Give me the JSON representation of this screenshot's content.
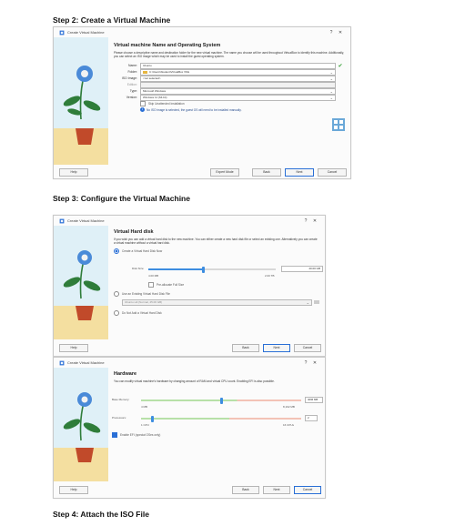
{
  "steps": {
    "step2": "Step 2: Create a Virtual Machine",
    "step3": "Step 3: Configure the Virtual Machine",
    "step4": "Step 4: Attach the ISO File"
  },
  "dialog1": {
    "window_title": "Create Virtual Machine",
    "heading": "Virtual machine Name and Operating System",
    "description": "Please choose a descriptive name and destination folder for the new virtual machine. The name you choose will be used throughout VirtualBox to identify this machine. Additionally, you can select an ISO image which may be used to install the guest operating system.",
    "fields": [
      {
        "label": "Name:",
        "value": "Ubuntu",
        "disabled": false
      },
      {
        "label": "Folder:",
        "value": "C:\\Users\\Student\\VirtualBox VMs",
        "disabled": false
      },
      {
        "label": "ISO Image:",
        "value": "<not selected>",
        "disabled": false
      },
      {
        "label": "Edition:",
        "value": "",
        "disabled": true
      },
      {
        "label": "Type:",
        "value": "Microsoft Windows",
        "disabled": false
      },
      {
        "label": "Version:",
        "value": "Windows 11 (64-bit)",
        "disabled": false
      }
    ],
    "skip_unattended": "Skip Unattended Installation",
    "info": "No ISO image is selected, the guest OS will need to be installed manually.",
    "buttons": {
      "help": "Help",
      "expert": "Expert Mode",
      "back": "Back",
      "next": "Next",
      "cancel": "Cancel"
    }
  },
  "dialog2": {
    "window_title": "Create Virtual Machine",
    "heading": "Virtual Hard disk",
    "description": "If you wish you can add a virtual hard disk to the new machine. You can either create a new hard disk file or select an existing one. Alternatively you can create a virtual machine without a virtual hard disk.",
    "option_create": "Create a Virtual Hard Disk Now",
    "disk_size_label": "Disk Size:",
    "disk_size_value": "40.00 GB",
    "disk_min": "4.00 MB",
    "disk_max": "2.00 TB",
    "disk_fraction": 0.43,
    "prealloc": "Pre-allocate Full Size",
    "option_existing": "Use an Existing Virtual Hard Disk File",
    "existing_value": "Ubuntu.vdi (Normal, 25.00 GB)",
    "option_none": "Do Not Add a Virtual Hard Disk",
    "buttons": {
      "help": "Help",
      "back": "Back",
      "next": "Next",
      "cancel": "Cancel"
    }
  },
  "dialog3": {
    "window_title": "Create Virtual Machine",
    "heading": "Hardware",
    "description": "You can modify virtual machine's hardware by changing amount of RAM and virtual CPU count. Enabling EFI is also possible.",
    "memory_label": "Base Memory:",
    "memory_value": "4096 MB",
    "memory_min": "4 MB",
    "memory_max": "8,192 MB",
    "memory_fraction": 0.5,
    "cpu_label": "Processors:",
    "cpu_value": "2",
    "cpu_min": "1 CPU",
    "cpu_max": "16 CPUs",
    "cpu_fraction": 0.07,
    "efi": "Enable EFI (special OSes only)",
    "buttons": {
      "help": "Help",
      "back": "Back",
      "next": "Next",
      "cancel": "Cancel"
    }
  },
  "colors": {
    "accent": "#2a6fd6",
    "slider": "#3d8de0",
    "sidebar_sky": "#dff0f7",
    "sidebar_sand": "#f4dfa0",
    "plant": "#2f7d3a",
    "flower": "#4a8ad8",
    "pot": "#c14a2a"
  },
  "icons": [
    "virtualbox-icon",
    "help-icon",
    "close-icon",
    "folder-icon",
    "check-icon",
    "os-icon",
    "info-icon",
    "dropdown-icon"
  ]
}
